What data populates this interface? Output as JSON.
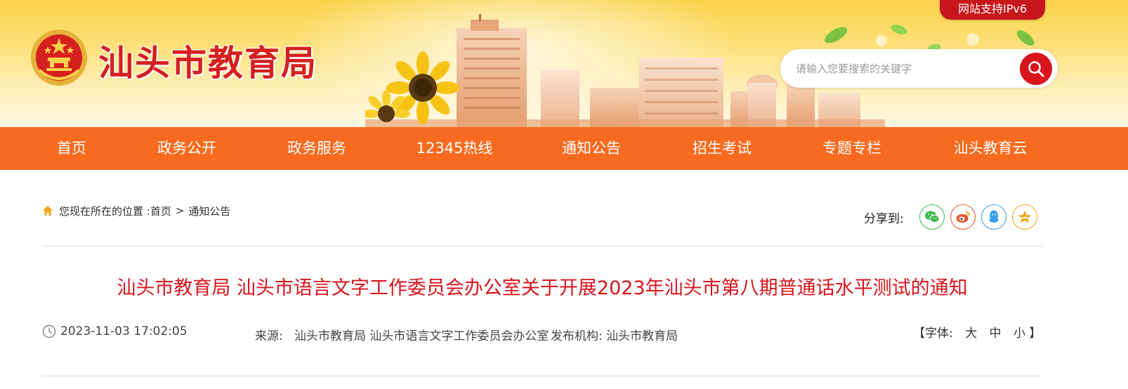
{
  "header": {
    "site_title": "汕头市教育局",
    "ipv6_badge": "网站支持IPv6",
    "search": {
      "placeholder": "请输入您要搜索的关键字",
      "icon": "search-icon"
    }
  },
  "nav": {
    "items": [
      {
        "label": "首页"
      },
      {
        "label": "政务公开"
      },
      {
        "label": "政务服务"
      },
      {
        "label": "12345热线"
      },
      {
        "label": "通知公告"
      },
      {
        "label": "招生考试"
      },
      {
        "label": "专题专栏"
      },
      {
        "label": "汕头教育云"
      }
    ]
  },
  "breadcrumb": {
    "prefix": "您现在所在的位置 : ",
    "home": "首页",
    "separator": ">",
    "current": "通知公告"
  },
  "share": {
    "label": "分享到:",
    "targets": [
      {
        "icon": "wechat-icon",
        "color": "#3fb94d"
      },
      {
        "icon": "weibo-icon",
        "color": "#e8532c"
      },
      {
        "icon": "qq-icon",
        "color": "#3a9ee8"
      },
      {
        "icon": "qzone-icon",
        "color": "#f2a516"
      }
    ]
  },
  "article": {
    "title": "汕头市教育局 汕头市语言文字工作委员会办公室关于开展2023年汕头市第八期普通话水平测试的通知",
    "datetime": "2023-11-03 17:02:05",
    "source_label": "来源:",
    "source_value": "汕头市教育局 汕头市语言文字工作委员会办公室",
    "publisher_label": "发布机构:",
    "publisher_value": "汕头市教育局",
    "font_size": {
      "open": "【字体:",
      "large": "大",
      "medium": "中",
      "small": "小",
      "close": "】"
    }
  },
  "colors": {
    "nav_bg": "#f76a1f",
    "title_red": "#d8141c",
    "brand_red": "#d61f1f"
  }
}
